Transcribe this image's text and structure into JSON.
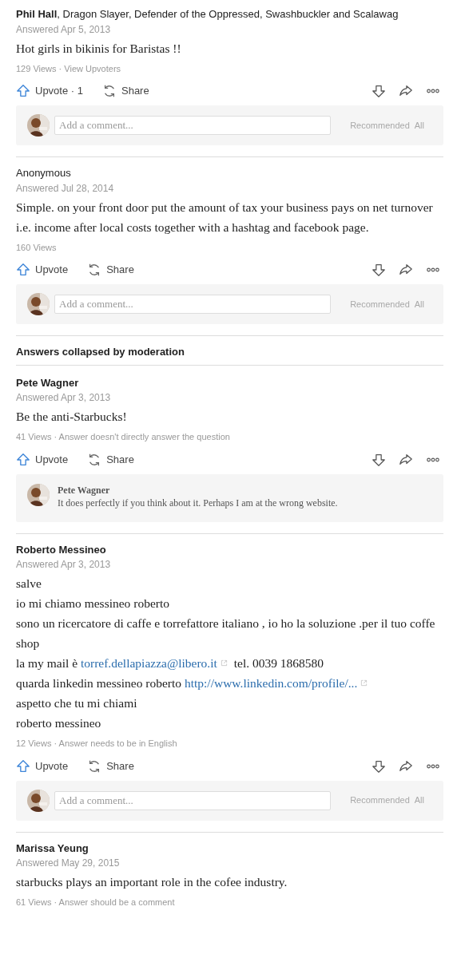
{
  "items": [
    {
      "kind": "answer",
      "author": "Phil Hall",
      "author_bold": true,
      "credential": ", Dragon Slayer, Defender of the Oppressed, Swashbuckler and Scalawag",
      "date": "Answered Apr 5, 2013",
      "paragraphs": [
        [
          {
            "kind": "text",
            "text": "Hot girls in bikinis for Baristas !!"
          }
        ]
      ],
      "stats": "129 Views · View Upvoters",
      "upvote": "Upvote · 1",
      "share": "Share",
      "comments": {
        "kind": "composer",
        "placeholder": "Add a comment...",
        "sort": [
          "Recommended",
          "All"
        ]
      }
    },
    {
      "kind": "answer",
      "author": "Anonymous",
      "author_bold": false,
      "date": "Answered Jul 28, 2014",
      "paragraphs": [
        [
          {
            "kind": "text",
            "text": "Simple. on your front door put the amount of tax your business pays on net turnover i.e. income after local costs together with a hashtag and facebook page."
          }
        ]
      ],
      "stats": "160 Views",
      "upvote": "Upvote",
      "share": "Share",
      "comments": {
        "kind": "composer",
        "placeholder": "Add a comment...",
        "sort": [
          "Recommended",
          "All"
        ]
      }
    },
    {
      "kind": "section_heading",
      "text": "Answers collapsed by moderation"
    },
    {
      "kind": "answer",
      "author": "Pete Wagner",
      "author_bold": true,
      "date": "Answered Apr 3, 2013",
      "paragraphs": [
        [
          {
            "kind": "text",
            "text": "Be the anti-Starbucks!"
          }
        ]
      ],
      "stats": "41 Views · Answer doesn't directly answer the question",
      "upvote": "Upvote",
      "share": "Share",
      "comments": {
        "kind": "comment",
        "author": "Pete Wagner",
        "text": "It does perfectly if you think about it.  Perhaps I am at the wrong website."
      }
    },
    {
      "kind": "answer",
      "author": "Roberto Messineo",
      "author_bold": true,
      "date": "Answered Apr 3, 2013",
      "paragraphs": [
        [
          {
            "kind": "text",
            "text": "salve"
          }
        ],
        [
          {
            "kind": "text",
            "text": "io mi chiamo messineo roberto"
          }
        ],
        [
          {
            "kind": "text",
            "text": "sono un ricercatore di caffe e torrefattore italiano , io ho la soluzione .per il tuo coffe shop"
          }
        ],
        [
          {
            "kind": "text",
            "text": "la my mail è "
          },
          {
            "kind": "link",
            "text": "torref.dellapiazza@libero.it"
          },
          {
            "kind": "text",
            "text": " tel. 0039 1868580"
          }
        ],
        [
          {
            "kind": "text",
            "text": "quarda linkedin messineo roberto "
          },
          {
            "kind": "link",
            "text": "http://www.linkedin.com/profile/..."
          }
        ],
        [
          {
            "kind": "text",
            "text": "aspetto che tu  mi chiami"
          }
        ],
        [
          {
            "kind": "text",
            "text": "roberto messineo"
          }
        ]
      ],
      "stats": "12 Views · Answer needs to be in English",
      "upvote": "Upvote",
      "share": "Share",
      "comments": {
        "kind": "composer",
        "placeholder": "Add a comment...",
        "sort": [
          "Recommended",
          "All"
        ]
      }
    },
    {
      "kind": "answer",
      "author": "Marissa Yeung",
      "author_bold": true,
      "date": "Answered May 29, 2015",
      "paragraphs": [
        [
          {
            "kind": "text",
            "text": "starbucks plays an important role in the cofee industry."
          }
        ]
      ],
      "stats": "61 Views · Answer should be a comment"
    }
  ]
}
